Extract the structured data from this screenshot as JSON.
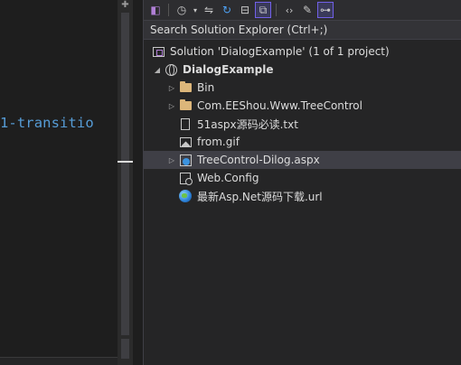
{
  "editor": {
    "code_text": "1-transitio"
  },
  "toolbar": {
    "items": [
      {
        "icon": "vs-icon"
      },
      {
        "icon": "history-icon"
      },
      {
        "icon": "dropdown-arrow-icon"
      },
      {
        "icon": "sync-icon"
      },
      {
        "icon": "refresh-icon"
      },
      {
        "icon": "collapse-all-icon"
      },
      {
        "icon": "show-all-files-icon"
      },
      {
        "icon": "view-code-icon"
      },
      {
        "icon": "properties-icon"
      },
      {
        "icon": "preview-icon"
      }
    ]
  },
  "search": {
    "placeholder": "Search Solution Explorer (Ctrl+;)"
  },
  "tree": {
    "solution": "Solution 'DialogExample' (1 of 1 project)",
    "project": "DialogExample",
    "items": [
      {
        "label": "Bin",
        "type": "folder",
        "expandable": true
      },
      {
        "label": "Com.EEShou.Www.TreeControl",
        "type": "folder",
        "expandable": true
      },
      {
        "label": "51aspx源码必读.txt",
        "type": "file",
        "expandable": false
      },
      {
        "label": "from.gif",
        "type": "image",
        "expandable": false
      },
      {
        "label": "TreeControl-Dilog.aspx",
        "type": "aspx",
        "expandable": true,
        "selected": true
      },
      {
        "label": "Web.Config",
        "type": "config",
        "expandable": false
      },
      {
        "label": "最新Asp.Net源码下载.url",
        "type": "url",
        "expandable": false
      }
    ]
  },
  "colors": {
    "background": "#1e1e1e",
    "panel": "#252526",
    "selection": "#3f3f46",
    "code_keyword": "#569cd6",
    "folder": "#dcb67a",
    "accent": "#7160e8"
  }
}
